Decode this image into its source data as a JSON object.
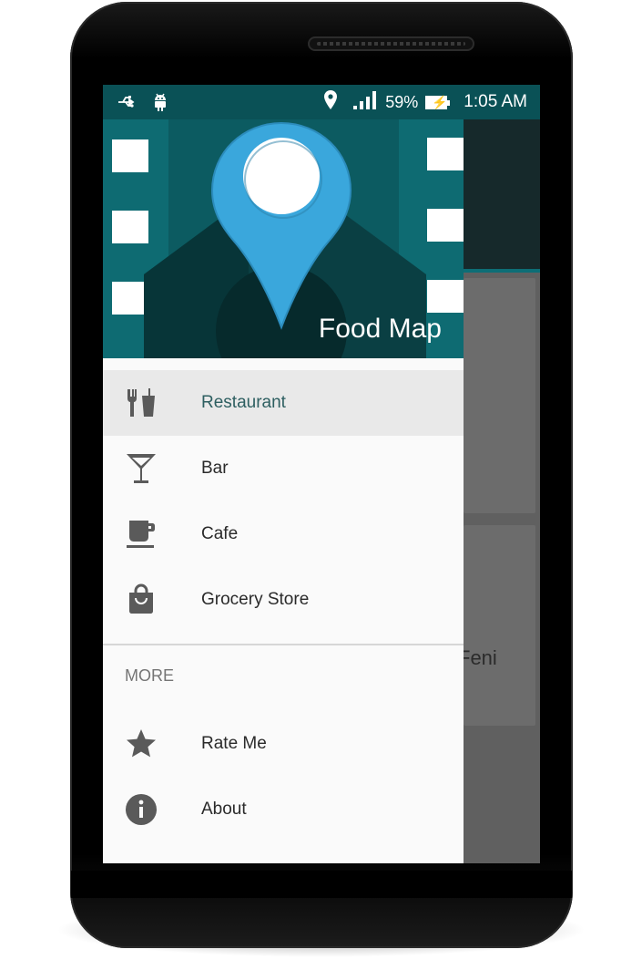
{
  "status_bar": {
    "battery": "59%",
    "time": "1:05 AM"
  },
  "drawer": {
    "header_title": "Food Map",
    "items": [
      {
        "label": "Restaurant",
        "icon": "restaurant-icon",
        "active": true
      },
      {
        "label": "Bar",
        "icon": "cocktail-icon"
      },
      {
        "label": "Cafe",
        "icon": "coffee-cup-icon"
      },
      {
        "label": "Grocery Store",
        "icon": "shopping-bag-icon"
      }
    ],
    "section_label": "MORE",
    "more_items": [
      {
        "label": "Rate Me",
        "icon": "star-icon"
      },
      {
        "label": "About",
        "icon": "info-icon"
      }
    ]
  },
  "background_content": {
    "partial_text": "Feni"
  },
  "colors": {
    "status_bar": "#0a5156",
    "header": "#0c5b61",
    "pin": "#3aa7dc",
    "active_item": "#e9e9e9",
    "icon": "#5a5a5a",
    "battery_bolt": "#2a9a46"
  }
}
